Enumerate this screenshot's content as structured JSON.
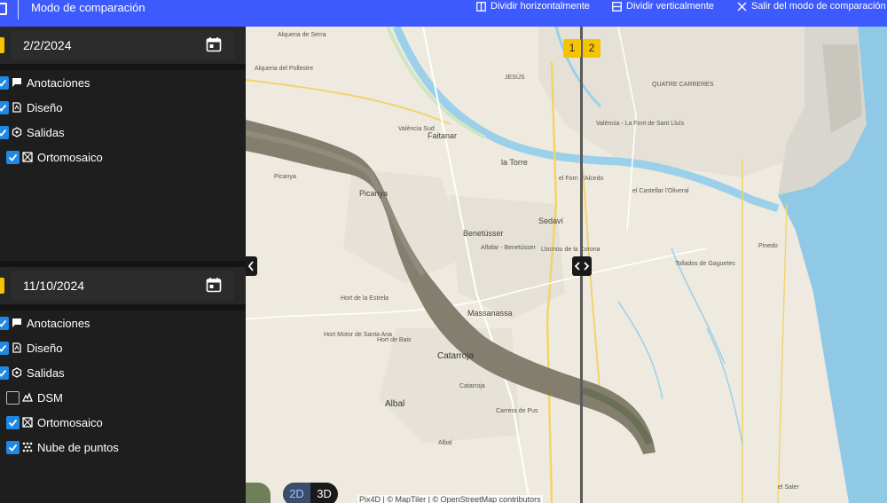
{
  "topbar": {
    "title": "Modo de comparación",
    "split_horizontal": "Dividir horizontalmente",
    "split_vertical": "Dividir verticalmente",
    "exit": "Salir del modo de comparación"
  },
  "panels": [
    {
      "date": "2/2/2024",
      "layers": [
        {
          "label": "Anotaciones",
          "icon": "comment-icon",
          "checked": true
        },
        {
          "label": "Diseño",
          "icon": "document-icon",
          "checked": true
        },
        {
          "label": "Salidas",
          "icon": "hexagon-icon",
          "checked": true
        },
        {
          "label": "Ortomosaico",
          "icon": "orthomosaic-icon",
          "checked": true
        }
      ]
    },
    {
      "date": "11/10/2024",
      "layers": [
        {
          "label": "Anotaciones",
          "icon": "comment-icon",
          "checked": true
        },
        {
          "label": "Diseño",
          "icon": "document-icon",
          "checked": true
        },
        {
          "label": "Salidas",
          "icon": "hexagon-icon",
          "checked": true
        },
        {
          "label": "DSM",
          "icon": "dsm-icon",
          "checked": false
        },
        {
          "label": "Ortomosaico",
          "icon": "orthomosaic-icon",
          "checked": true
        },
        {
          "label": "Nube de puntos",
          "icon": "point-cloud-icon",
          "checked": true
        }
      ]
    }
  ],
  "map": {
    "badge_left": "1",
    "badge_right": "2",
    "view_2d": "2D",
    "view_3d": "3D",
    "attribution": "Pix4D | © MapTiler | © OpenStreetMap contributors",
    "labels": {
      "alqueria": "Alqueria de Serra",
      "alqueria_pollestre": "Alqueria del Pollestre",
      "quatre_carreres": "QUATRE CARRERES",
      "jesus": "JESÚS",
      "faitanar": "Faitanar",
      "valencia_sud": "València Sud",
      "valencia_font": "València - La Font de Sant Lluís",
      "la_torre": "la Torre",
      "fonteta": "el Forn d'Alcedo",
      "castellar": "el Castellar l'Oliveral",
      "sedavi": "Sedaví",
      "benetusser": "Benetússer",
      "alfafar": "Alfafar - Benetússer",
      "lloc_nou": "Llocnou de la Corona",
      "picassent": "Picanya",
      "pinedo": "Pinedo",
      "catarroja": "Catarroja",
      "albal": "Albal",
      "massanassa": "Massanassa",
      "forn": "Tollados de Gaguetes",
      "saler": "el Saler",
      "torre_espioca": "Hort de la Estrela",
      "hort": "Hort de Baix",
      "hort_santa_anna": "Hort Motor de Santa Ana",
      "carrera": "Carrera de Pus",
      "albal_station": "Albal",
      "catarroja_station": "Catarroja",
      "benet_station": "Picanya"
    }
  },
  "colors": {
    "accent": "#3d5afe",
    "checkbox": "#1e88e5",
    "marker": "#f5c400",
    "water": "#8fc9e6",
    "river": "#9bd0ea",
    "sidebar": "#1e1e1e"
  }
}
